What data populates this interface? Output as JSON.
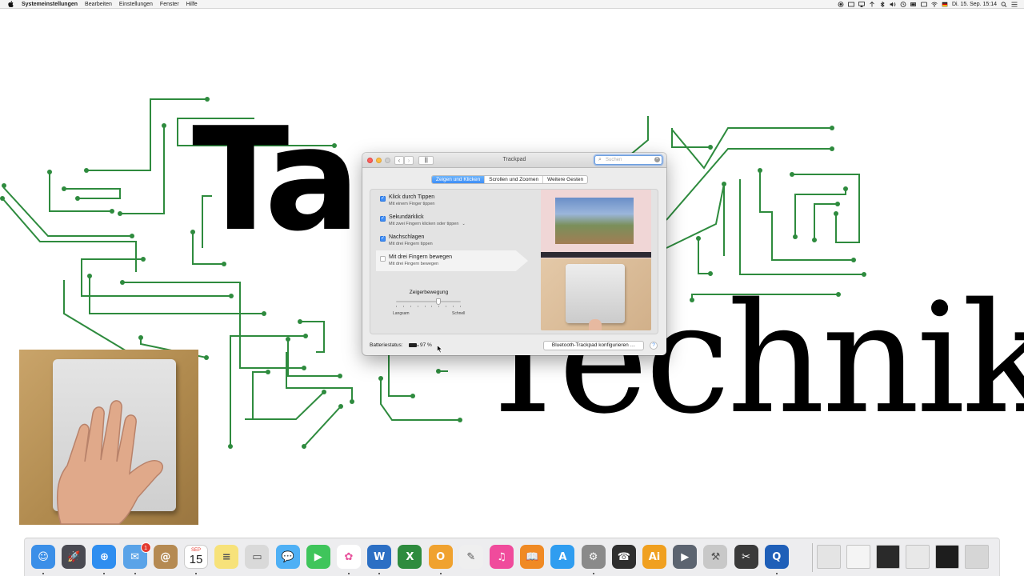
{
  "menubar": {
    "items": [
      "Systemeinstellungen",
      "Bearbeiten",
      "Einstellungen",
      "Fenster",
      "Hilfe"
    ],
    "clock": "Di. 15. Sep.  15:14",
    "status_icons": [
      "record-icon",
      "volume-icon",
      "airplay-display-icon",
      "airplay-icon",
      "bluetooth-icon",
      "sound-icon",
      "time-machine-icon",
      "bluetooth-battery-icon",
      "display-icon",
      "wifi-icon",
      "flag-icon",
      "spotlight-icon",
      "list-icon"
    ]
  },
  "wallpaper": {
    "logo_top": "Ta",
    "logo_bottom": "Technik",
    "circuit_color": "#2e8b3e"
  },
  "window": {
    "title": "Trackpad",
    "search_placeholder": "Suchen",
    "tabs": [
      "Zeigen und Klicken",
      "Scrollen und Zoomen",
      "Weitere Gesten"
    ],
    "active_tab": 0,
    "options": [
      {
        "label": "Klick durch Tippen",
        "sub": "Mit einem Finger tippen",
        "checked": true
      },
      {
        "label": "Sekundärklick",
        "sub": "Mit zwei Fingern klicken oder tippen",
        "checked": true
      },
      {
        "label": "Nachschlagen",
        "sub": "Mit drei Fingern tippen",
        "checked": true
      },
      {
        "label": "Mit drei Fingern bewegen",
        "sub": "Mit drei Fingern bewegen",
        "checked": false
      }
    ],
    "slider": {
      "title": "Zeigerbewegung",
      "low": "Langsam",
      "high": "Schnell",
      "level": 0.65
    },
    "battery_label": "Batteriestatus:",
    "battery_value": "97 %",
    "battery_level": 0.97,
    "config_button": "Bluetooth-Trackpad konfigurieren …",
    "help": "?"
  },
  "calendar": {
    "month": "SEP",
    "day": "15"
  },
  "dock": {
    "apps": [
      {
        "name": "finder-icon",
        "color": "#3b8fe8",
        "glyph": "☺"
      },
      {
        "name": "launchpad-icon",
        "color": "#4a4a52",
        "glyph": "🚀"
      },
      {
        "name": "safari-icon",
        "color": "#2f8ef0",
        "glyph": "⊕"
      },
      {
        "name": "mail-icon",
        "color": "#5aa3e8",
        "glyph": "✉"
      },
      {
        "name": "contacts-icon",
        "color": "#b58a52",
        "glyph": "@"
      },
      {
        "name": "calendar-icon",
        "color": "#ffffff",
        "glyph": ""
      },
      {
        "name": "notes-icon",
        "color": "#f7e27a",
        "glyph": "≡"
      },
      {
        "name": "preview-icon",
        "color": "#d9d9d9",
        "glyph": "▭"
      },
      {
        "name": "messages-icon",
        "color": "#4fb0f5",
        "glyph": "💬"
      },
      {
        "name": "facetime-icon",
        "color": "#3fc55b",
        "glyph": "▶"
      },
      {
        "name": "photos-icon",
        "color": "#ffffff",
        "glyph": "✿"
      },
      {
        "name": "word-icon",
        "color": "#2c6fc4",
        "glyph": "W"
      },
      {
        "name": "excel-icon",
        "color": "#2e8b3e",
        "glyph": "X"
      },
      {
        "name": "outlook-icon",
        "color": "#f0a22f",
        "glyph": "O"
      },
      {
        "name": "textedit-icon",
        "color": "#efefef",
        "glyph": "✎"
      },
      {
        "name": "itunes-icon",
        "color": "#f04b9c",
        "glyph": "♫"
      },
      {
        "name": "ibooks-icon",
        "color": "#f08a24",
        "glyph": "📖"
      },
      {
        "name": "app-store-icon",
        "color": "#2f9df0",
        "glyph": "A"
      },
      {
        "name": "system-preferences-icon",
        "color": "#8a8a8a",
        "glyph": "⚙"
      },
      {
        "name": "phone-icon",
        "color": "#2f2f2f",
        "glyph": "☎"
      },
      {
        "name": "illustrator-icon",
        "color": "#f0a020",
        "glyph": "Ai"
      },
      {
        "name": "video-icon",
        "color": "#5c6470",
        "glyph": "▶"
      },
      {
        "name": "utility-icon",
        "color": "#c8c8c8",
        "glyph": "⚒"
      },
      {
        "name": "final-cut-icon",
        "color": "#3a3a3a",
        "glyph": "✂"
      },
      {
        "name": "quicktime-icon",
        "color": "#1f5fb8",
        "glyph": "Q"
      }
    ],
    "stacks": [
      {
        "name": "documents-stack-icon",
        "color": "#e4e4e4"
      },
      {
        "name": "downloads-stack-icon",
        "color": "#f4f4f4"
      },
      {
        "name": "screenshot-stack-icon",
        "color": "#2a2a2a"
      },
      {
        "name": "folder-stack-icon",
        "color": "#e8e8e8"
      },
      {
        "name": "terminal-stack-icon",
        "color": "#1d1d1d"
      },
      {
        "name": "trash-icon",
        "color": "#d6d6d6"
      }
    ],
    "mail_badge": "1"
  }
}
